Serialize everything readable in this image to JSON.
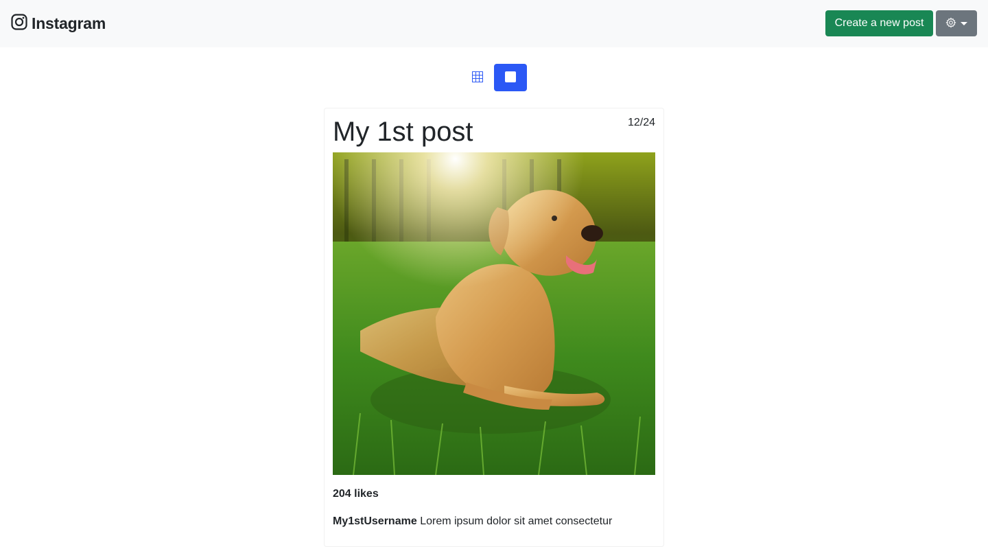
{
  "navbar": {
    "brand": "Instagram",
    "brand_icon": "instagram-logo-icon",
    "create_button_label": "Create a new post",
    "settings_icon": "gear-icon",
    "create_color": "#198754",
    "settings_color": "#6c757d"
  },
  "view_toggle": {
    "options": [
      {
        "name": "grid-view",
        "icon": "grid-icon",
        "active": false
      },
      {
        "name": "single-view",
        "icon": "square-icon",
        "active": true
      }
    ],
    "active_color": "#2b58f5"
  },
  "post": {
    "title": "My 1st post",
    "date": "12/24",
    "image_subject": "golden-retriever-in-grass",
    "likes": "204 likes",
    "username": "My1stUsername",
    "caption": "Lorem ipsum dolor sit amet consectetur"
  }
}
